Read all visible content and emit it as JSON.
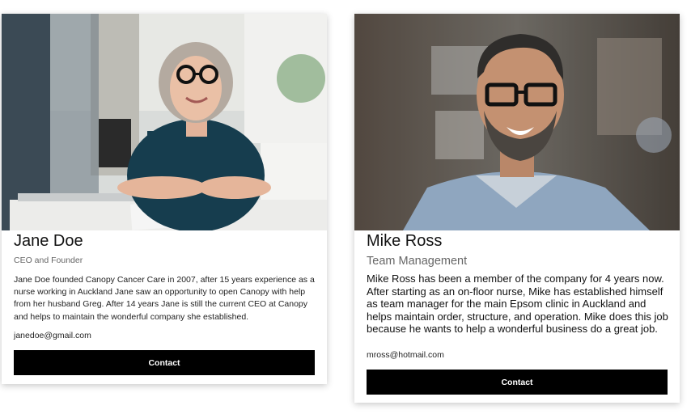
{
  "members": [
    {
      "name": "Jane Doe",
      "role": "CEO and Founder",
      "bio": "Jane Doe founded Canopy Cancer Care in 2007, after 15 years experience as a nurse working in Auckland Jane saw an opportunity to open Canopy with help from her husband Greg. After 14 years Jane is still the current CEO at Canopy and helps to maintain the wonderful company she established.",
      "email": "janedoe@gmail.com",
      "button": "Contact"
    },
    {
      "name": "Mike Ross",
      "role": "Team Management",
      "bio": "Mike Ross has been a member of the company for 4 years now. After starting as an on-floor nurse, Mike has established himself as team manager for the main Epsom clinic in Auckland and helps maintain order, structure, and operation. Mike does this job because he wants to help a wonderful business do a great job.",
      "email": "mross@hotmail.com",
      "button": "Contact"
    }
  ]
}
